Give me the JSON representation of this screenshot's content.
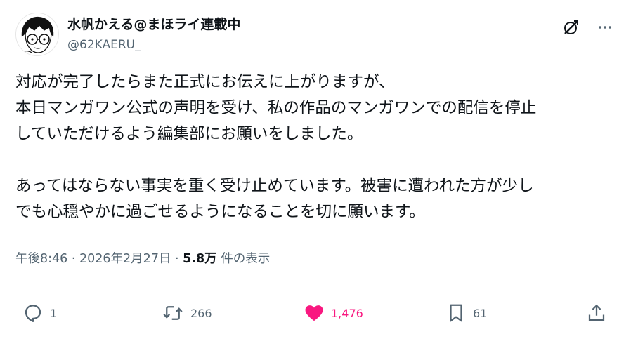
{
  "author": {
    "display_name": "水帆かえる@まほライ連載中",
    "handle": "@62KAERU_"
  },
  "tweet": {
    "text": "対応が完了したらまた正式にお伝えに上がりますが、\n本日マンガワン公式の声明を受け、私の作品のマンガワンでの配信を停止\nしていただけるよう編集部にお願いをしました。\n\nあってはならない事実を重く受け止めています。被害に遭われた方が少し\nでも心穏やかに過ごせるようになることを切に願います。"
  },
  "meta": {
    "time": "午後8:46",
    "sep1": " · ",
    "date": "2026年2月27日",
    "sep2": " · ",
    "views_count": "5.8万",
    "views_label": " 件の表示"
  },
  "actions": {
    "reply_count": "1",
    "retweet_count": "266",
    "like_count": "1,476",
    "bookmark_count": "61"
  },
  "icons": {
    "top": [
      "grok-icon",
      "more-icon"
    ],
    "actions": [
      "reply-icon",
      "retweet-icon",
      "like-icon",
      "bookmark-icon",
      "share-icon"
    ]
  },
  "colors": {
    "text": "#0f1419",
    "secondary": "#536471",
    "like": "#f91880",
    "divider": "#eff3f4"
  }
}
